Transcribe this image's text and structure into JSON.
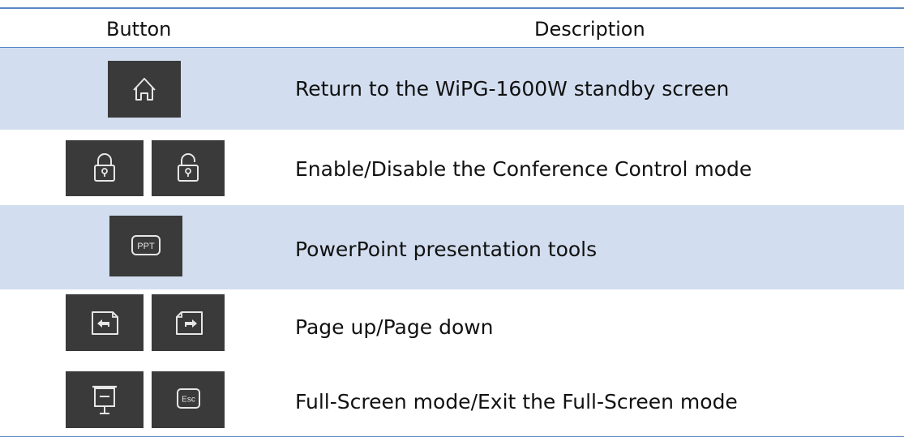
{
  "table": {
    "headers": {
      "button": "Button",
      "description": "Description"
    },
    "rows": [
      {
        "icons": [
          "home-icon"
        ],
        "description": "Return to the WiPG-1600W standby screen"
      },
      {
        "icons": [
          "lock-icon",
          "unlock-icon"
        ],
        "description": "Enable/Disable the Conference Control mode"
      },
      {
        "icons": [
          "ppt-icon"
        ],
        "description": "PowerPoint presentation tools"
      },
      {
        "icons": [
          "page-up-icon",
          "page-down-icon"
        ],
        "description": "Page up/Page down"
      },
      {
        "icons": [
          "full-screen-icon",
          "esc-icon"
        ],
        "description": "Full-Screen mode/Exit the Full-Screen mode"
      }
    ],
    "icon_labels": {
      "ppt": "PPT",
      "esc": "Esc"
    }
  },
  "colors": {
    "border": "#5b87c4",
    "shaded_row": "#d2deef",
    "button_bg": "#3a3a3a",
    "icon_stroke": "#e6e6e6"
  }
}
